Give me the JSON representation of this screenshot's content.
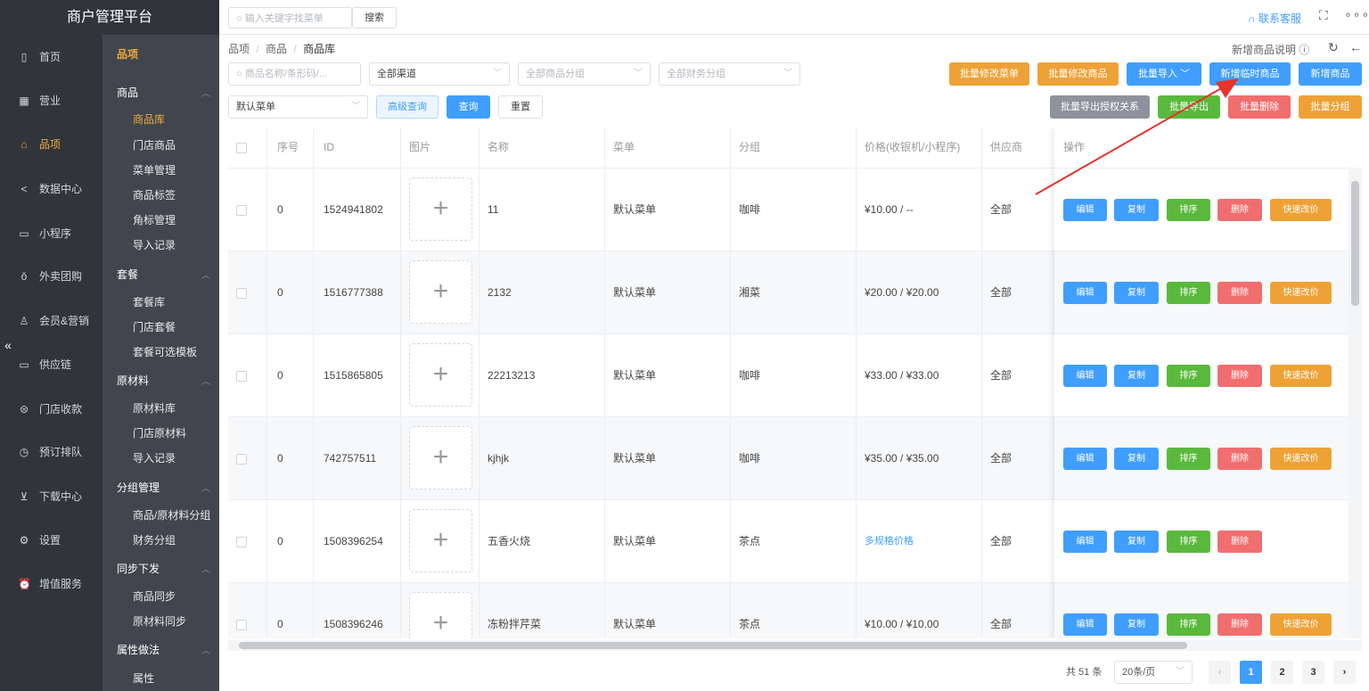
{
  "brand": "商户管理平台",
  "nav": [
    {
      "label": "首页",
      "icon": "file-icon"
    },
    {
      "label": "营业",
      "icon": "calendar-icon"
    },
    {
      "label": "品项",
      "icon": "bag-icon"
    },
    {
      "label": "数据中心",
      "icon": "share-icon"
    },
    {
      "label": "小程序",
      "icon": "monitor-icon"
    },
    {
      "label": "外卖团购",
      "icon": "bike-icon"
    },
    {
      "label": "会员&营销",
      "icon": "user-icon"
    },
    {
      "label": "供应链",
      "icon": "truck-icon"
    },
    {
      "label": "门店收款",
      "icon": "wallet-icon"
    },
    {
      "label": "预订排队",
      "icon": "clock-icon"
    },
    {
      "label": "下载中心",
      "icon": "download-icon"
    },
    {
      "label": "设置",
      "icon": "gear-icon"
    },
    {
      "label": "增值服务",
      "icon": "alarm-icon"
    }
  ],
  "submenu": {
    "title": "品项",
    "goods": "商品",
    "goods_lib": "商品库",
    "store_goods": "门店商品",
    "menu_mgmt": "菜单管理",
    "goods_tag": "商品标签",
    "corner_mgmt": "角标管理",
    "import_log": "导入记录",
    "combo": "套餐",
    "combo_lib": "套餐库",
    "store_combo": "门店套餐",
    "combo_tpl": "套餐可选模板",
    "material": "原材料",
    "material_lib": "原材料库",
    "store_material": "门店原材料",
    "material_import": "导入记录",
    "group_mgmt": "分组管理",
    "goods_group": "商品/原材料分组",
    "finance_group": "财务分组",
    "sync": "同步下发",
    "goods_sync": "商品同步",
    "material_sync": "原材料同步",
    "attr": "属性做法",
    "attr_item": "属性"
  },
  "topbar": {
    "search_placeholder": "输入关键字找菜单",
    "search_button": "搜索",
    "contact": "联系客服"
  },
  "breadcrumb": {
    "l1": "品项",
    "l2": "商品",
    "l3": "商品库",
    "sep": "/"
  },
  "help": "新增商品说明",
  "filters": {
    "name_placeholder": "商品名称/条形码/...",
    "channel": "全部渠道",
    "category": "全部商品分组",
    "finance": "全部财务分组",
    "menu": "默认菜单",
    "advanced": "高级查询",
    "query": "查询",
    "reset": "重置"
  },
  "actions": {
    "batch_menu": "批量修改菜单",
    "batch_goods": "批量修改商品",
    "batch_import": "批量导入",
    "new_temp": "新增临时商品",
    "new_goods": "新增商品",
    "export_auth": "批量导出授权关系",
    "batch_export": "批量导出",
    "batch_delete": "批量删除",
    "batch_group": "批量分组"
  },
  "columns": {
    "seq": "序号",
    "id": "ID",
    "image": "图片",
    "name": "名称",
    "menu": "菜单",
    "group": "分组",
    "price": "价格(收银机/小程序)",
    "supplier": "供应商",
    "ops": "操作"
  },
  "rows": [
    {
      "seq": "0",
      "id": "1524941802",
      "name": "11",
      "menu": "默认菜单",
      "group": "咖啡",
      "price": "¥10.00 / --",
      "supplier": "全部",
      "quick": true,
      "link": false
    },
    {
      "seq": "0",
      "id": "1516777388",
      "name": "2132",
      "menu": "默认菜单",
      "group": "湘菜",
      "price": "¥20.00 / ¥20.00",
      "supplier": "全部",
      "quick": true,
      "link": false
    },
    {
      "seq": "0",
      "id": "1515865805",
      "name": "22213213",
      "menu": "默认菜单",
      "group": "咖啡",
      "price": "¥33.00 / ¥33.00",
      "supplier": "全部",
      "quick": true,
      "link": false
    },
    {
      "seq": "0",
      "id": "742757511",
      "name": "kjhjk",
      "menu": "默认菜单",
      "group": "咖啡",
      "price": "¥35.00 / ¥35.00",
      "supplier": "全部",
      "quick": true,
      "link": false
    },
    {
      "seq": "0",
      "id": "1508396254",
      "name": "五香火烧",
      "menu": "默认菜单",
      "group": "茶点",
      "price": "多规格价格",
      "supplier": "全部",
      "quick": false,
      "link": true
    },
    {
      "seq": "0",
      "id": "1508396246",
      "name": "冻粉拌芹菜",
      "menu": "默认菜单",
      "group": "茶点",
      "price": "¥10.00 / ¥10.00",
      "supplier": "全部",
      "quick": true,
      "link": false
    }
  ],
  "row_ops": {
    "edit": "编辑",
    "copy": "复制",
    "sort": "排序",
    "delete": "删除",
    "quick": "快速改价"
  },
  "pagination": {
    "total": "共 51 条",
    "size": "20条/页",
    "pages": [
      "1",
      "2",
      "3"
    ],
    "current": "1"
  },
  "colors": {
    "accent": "#f0a93b",
    "primary": "#409eff",
    "arrow": "#e8322c"
  }
}
